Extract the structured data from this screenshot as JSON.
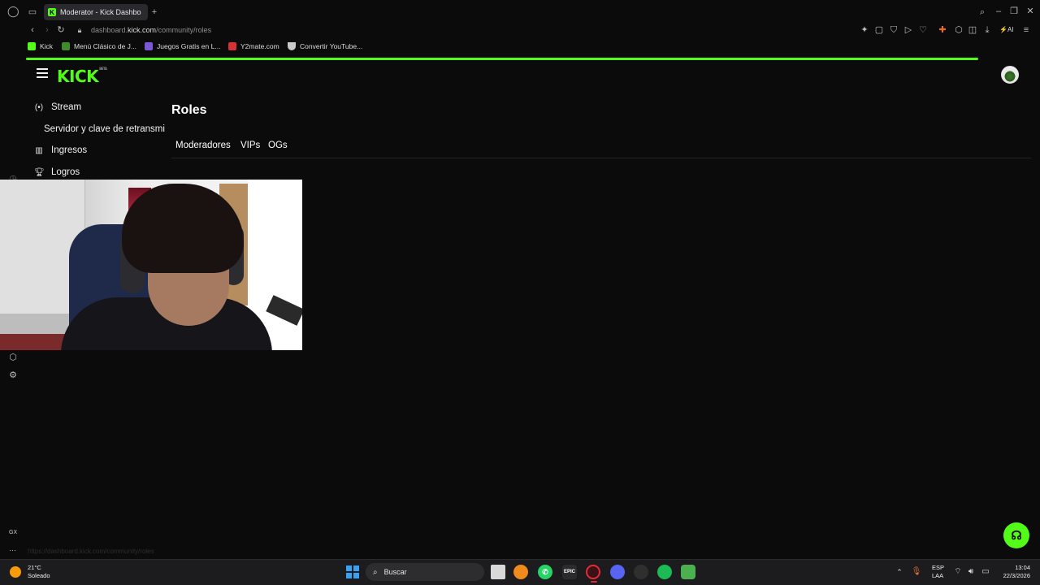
{
  "browser": {
    "tab_title": "Moderator - Kick Dashboa",
    "url_prefix": "dashboard.",
    "url_domain": "kick.com",
    "url_path": "/community/roles",
    "bookmarks": [
      {
        "label": "Kick",
        "color": "#53fc18"
      },
      {
        "label": "Menú Clásico de J...",
        "color": "#3f8a2a"
      },
      {
        "label": "Juegos Gratis en L...",
        "color": "#7b58d8"
      },
      {
        "label": "Y2mate.com",
        "color": "#d43333"
      },
      {
        "label": "Convertir YouTube...",
        "color": "#c9c9c9"
      }
    ],
    "ai_label": "AI"
  },
  "header": {
    "logo_text": "KICK",
    "logo_badge": "BETA"
  },
  "sidebar": {
    "items": [
      {
        "label": "Stream",
        "icon": "broadcast-icon"
      },
      {
        "label": "Servidor y clave de retransmi",
        "icon": ""
      },
      {
        "label": "Ingresos",
        "icon": "bar-chart-icon"
      },
      {
        "label": "Logros",
        "icon": "trophy-icon"
      }
    ]
  },
  "main": {
    "title": "Roles",
    "tabs": [
      "Moderadores",
      "VIPs",
      "OGs"
    ]
  },
  "status_url": "https://dashboard.kick.com/community/roles",
  "leftrail": {
    "gx_label": "GX",
    "more_label": "···"
  },
  "taskbar": {
    "weather_temp": "21°C",
    "weather_desc": "Soleado",
    "search_placeholder": "Buscar",
    "lang_1": "ESP",
    "lang_2": "LAA",
    "time": "13:04",
    "date": "22/3/2026"
  },
  "colors": {
    "accent": "#53fc18",
    "background": "#0b0b0c"
  }
}
